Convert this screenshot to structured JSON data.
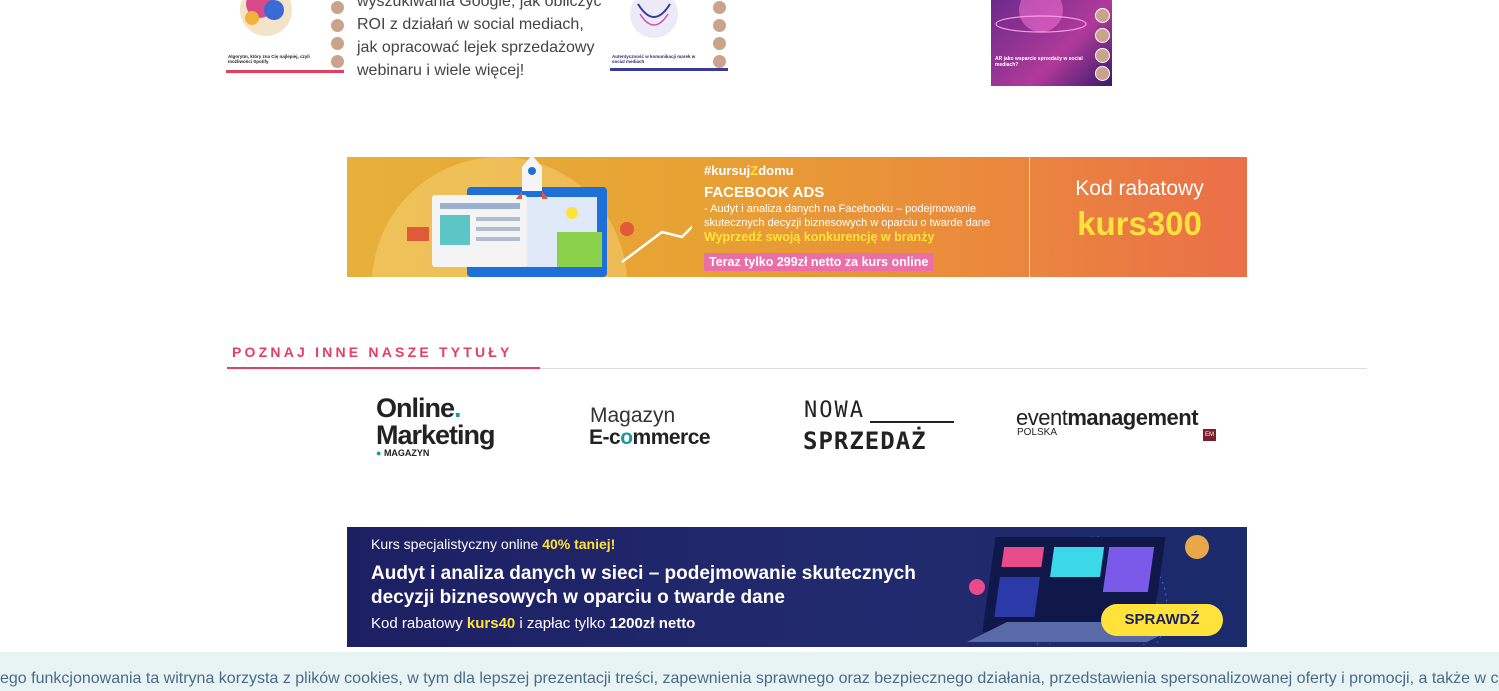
{
  "article_row": {
    "snippet": "wyszukiwania Google, jak obliczyć ROI z działań w social mediach, jak opracować lejek sprzedażowy webinaru i wiele więcej!",
    "thumb1_caption": "Algorytm, który zna Cię najlepiej, czyli możliwości Spotify",
    "thumb2_caption": "Autentyczność w komunikacji marek w social mediach",
    "thumb3_caption": "AR jako wsparcie sprzedaży w social mediach?"
  },
  "banner_facebook": {
    "tag_prefix": "#kursuj",
    "tag_z": "Z",
    "tag_suffix": "domu",
    "heading": "FACEBOOK ADS",
    "description": "- Audyt i analiza danych na Facebooku – podejmowanie skutecznych decyzji biznesowych w oparciu o twarde dane",
    "highlight": "Wyprzedź swoją konkurencję w branży",
    "price": "Teraz tylko 299zł netto za kurs online",
    "code_label": "Kod rabatowy",
    "code": "kurs300"
  },
  "section": {
    "title": "POZNAJ INNE NASZE TYTUŁY"
  },
  "logos": {
    "online_line1": "Online",
    "online_line2": "Marketing",
    "online_line3": "MAGAZYN",
    "magazyn_line1": "Magazyn",
    "magazyn_line2_a": "E-c",
    "magazyn_line2_o": "o",
    "magazyn_line2_b": "mmerce",
    "nowa_line1": "NOWA",
    "nowa_line2": "SPRZEDAŻ",
    "event_light": "event",
    "event_bold": "management",
    "event_sub": "POLSKA",
    "event_badge": "EM"
  },
  "banner_audit": {
    "line1_prefix": "Kurs specjalistyczny online ",
    "line1_highlight": "40% taniej!",
    "title": "Audyt i analiza danych w sieci – podejmowanie skutecznych decyzji biznesowych w oparciu o twarde dane",
    "line3_prefix": "Kod rabatowy ",
    "line3_code": "kurs40",
    "line3_middle": " i zapłac tylko ",
    "line3_price": "1200zł netto",
    "button": "SPRAWDŹ"
  },
  "cookie": {
    "text": "ego funkcjonowania ta witryna korzysta z plików cookies, w tym dla lepszej prezentacji treści, zapewnienia sprawnego oraz bezpiecznego działania, przedstawienia spersonalizowanej oferty i promocji, a także w ce"
  },
  "colors": {
    "accent_pink": "#e53e63",
    "teal": "#1a9a9a",
    "yellow": "#ffe23a",
    "navy": "#1d1f63"
  }
}
